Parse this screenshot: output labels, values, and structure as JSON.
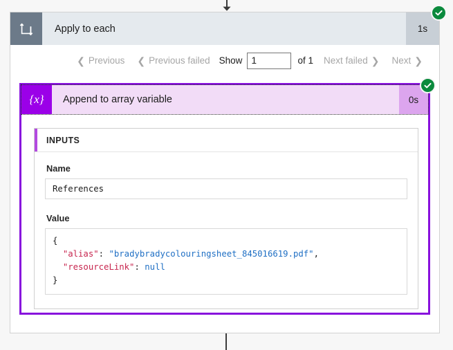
{
  "colors": {
    "scope_icon_bg": "#6c7a89",
    "scope_header_bg": "#e5eaee",
    "scope_duration_bg": "#c8cfd6",
    "action_border": "#8811dd",
    "action_icon_bg": "#9b00e8",
    "action_header_bg": "#f2dcf7",
    "action_duration_bg": "#dca5ee",
    "inputs_accent": "#b34ae0",
    "success_green": "#0b8a3d",
    "json_key": "#c7254e",
    "json_string": "#1f6fc4",
    "page_bg": "#f7f7f7"
  },
  "connectors": {
    "top_arrow_icon": "arrow-down-icon",
    "bottom_line": "flow-connector-line"
  },
  "scope": {
    "icon": "apply-to-each-loop-icon",
    "title": "Apply to each",
    "duration": "1s",
    "status_icon": "success-check-icon"
  },
  "pager": {
    "previous_label": "Previous",
    "previous_failed_label": "Previous failed",
    "show_label": "Show",
    "page_value": "1",
    "of_label": "of 1",
    "next_failed_label": "Next failed",
    "next_label": "Next",
    "chevron_left": "❮",
    "chevron_right": "❯"
  },
  "action": {
    "icon": "variable-braces-icon",
    "icon_glyph": "{x}",
    "title": "Append to array variable",
    "duration": "0s",
    "status_icon": "success-check-icon",
    "inputs": {
      "section_title": "INPUTS",
      "name_label": "Name",
      "name_value": "References",
      "value_label": "Value",
      "value_json": {
        "open_brace": "{",
        "line1": {
          "key": "\"alias\"",
          "colon": ": ",
          "value": "\"bradybradycolouringsheet_845016619.pdf\"",
          "comma": ","
        },
        "line2": {
          "key": "\"resourceLink\"",
          "colon": ": ",
          "value": "null"
        },
        "close_brace": "}"
      }
    }
  }
}
